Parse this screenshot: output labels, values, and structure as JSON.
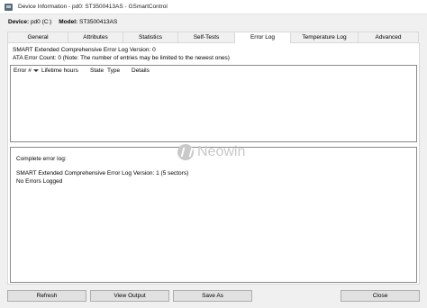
{
  "window": {
    "title": "Device Information - pd0: ST3500413AS - GSmartControl"
  },
  "device": {
    "device_label": "Device:",
    "device_value": "pd0 (C:)",
    "model_label": "Model:",
    "model_value": "ST3500413AS"
  },
  "tabs": [
    {
      "label": "General",
      "active": false
    },
    {
      "label": "Attributes",
      "active": false
    },
    {
      "label": "Statistics",
      "active": false
    },
    {
      "label": "Self-Tests",
      "active": false
    },
    {
      "label": "Error Log",
      "active": true
    },
    {
      "label": "Temperature Log",
      "active": false
    },
    {
      "label": "Advanced",
      "active": false
    }
  ],
  "error_log": {
    "version_line": "SMART Extended Comprehensive Error Log Version: 0",
    "count_line": "ATA Error Count: 0 (Note: The number of entries may be limited to the newest ones)",
    "columns": [
      "Error #",
      "Lifetime hours",
      "State",
      "Type",
      "Details"
    ],
    "complete_log": [
      "Complete error log:",
      "SMART Extended Comprehensive Error Log Version: 1 (5 sectors)",
      "No Errors Logged"
    ]
  },
  "watermark": {
    "text": "Neowin"
  },
  "buttons": {
    "refresh": "Refresh",
    "view_output": "View Output",
    "save_as": "Save As",
    "close": "Close"
  }
}
